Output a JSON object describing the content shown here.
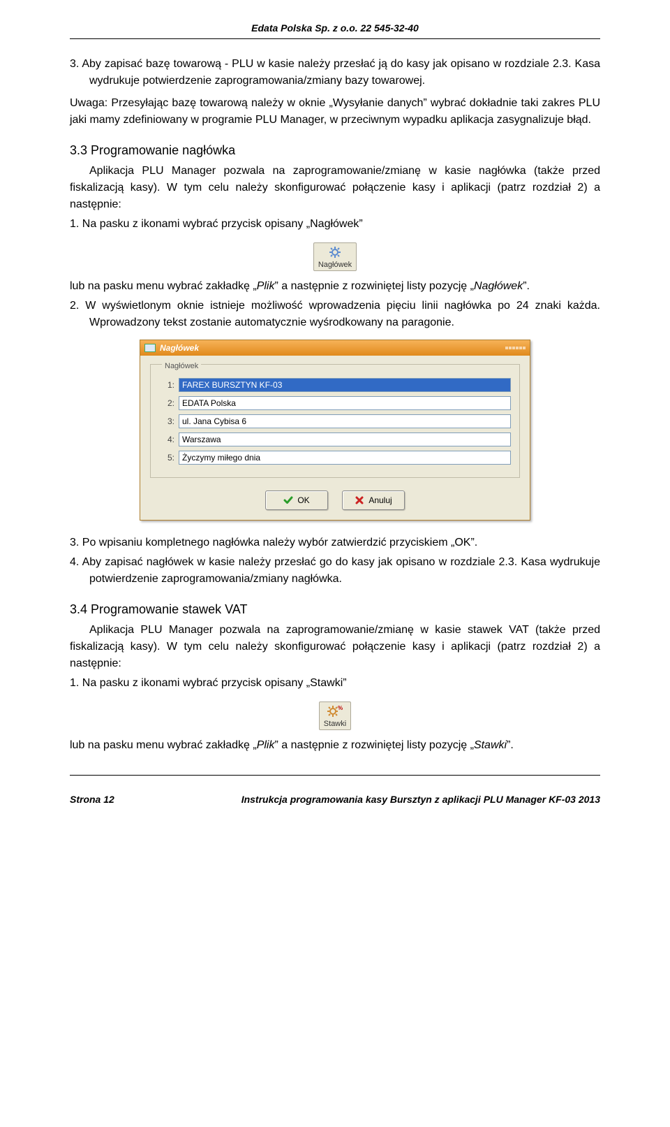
{
  "header": {
    "company": "Edata Polska Sp. z o.o. 22 545-32-40"
  },
  "p1_item3": "3.  Aby zapisać bazę towarową - PLU w kasie należy przesłać ją do kasy jak opisano w rozdziale 2.3. Kasa wydrukuje potwierdzenie zaprogramowania/zmiany bazy towarowej.",
  "p1_uwaga": "Uwaga: Przesyłając bazę towarową należy w oknie „Wysyłanie danych” wybrać dokładnie taki zakres PLU jaki mamy zdefiniowany w programie PLU Manager, w przeciwnym wypadku aplikacja zasygnalizuje błąd.",
  "sec33_title": "3.3 Programowanie nagłówka",
  "sec33_p1": "Aplikacja PLU Manager pozwala na zaprogramowanie/zmianę w kasie nagłówka (także przed fiskalizacją kasy). W tym celu należy skonfigurować połączenie kasy i aplikacji (patrz rozdział 2) a następnie:",
  "sec33_li1": "1.  Na pasku z ikonami wybrać przycisk opisany „Nagłówek”",
  "btn_naglowek_label": "Nagłówek",
  "sec33_p2_a": "lub na pasku menu wybrać zakładkę „",
  "sec33_p2_i": "Plik",
  "sec33_p2_b": "” a następnie z rozwiniętej listy pozycję „",
  "sec33_p2_i2": "Nagłówek",
  "sec33_p2_c": "”.",
  "sec33_li2": "2.  W wyświetlonym oknie istnieje możliwość wprowadzenia pięciu linii nagłówka po 24 znaki każda. Wprowadzony tekst zostanie automatycznie wyśrodkowany na paragonie.",
  "dialog": {
    "title": "Nagłówek",
    "legend": "Nagłówek",
    "rows": [
      {
        "num": "1:",
        "value": "FAREX BURSZTYN KF-03",
        "selected": true
      },
      {
        "num": "2:",
        "value": "EDATA Polska",
        "selected": false
      },
      {
        "num": "3:",
        "value": "ul. Jana Cybisa 6",
        "selected": false
      },
      {
        "num": "4:",
        "value": "Warszawa",
        "selected": false
      },
      {
        "num": "5:",
        "value": "Życzymy miłego dnia",
        "selected": false
      }
    ],
    "ok": "OK",
    "cancel": "Anuluj"
  },
  "sec33_li3": "3.  Po wpisaniu kompletnego nagłówka należy wybór zatwierdzić przyciskiem „OK”.",
  "sec33_li4": "4.  Aby zapisać nagłówek w kasie należy przesłać go do kasy jak opisano w rozdziale 2.3. Kasa wydrukuje potwierdzenie zaprogramowania/zmiany nagłówka.",
  "sec34_title": "3.4 Programowanie stawek VAT",
  "sec34_p1": "Aplikacja PLU Manager pozwala na zaprogramowanie/zmianę w kasie stawek VAT (także przed fiskalizacją kasy). W tym celu należy skonfigurować połączenie kasy i aplikacji (patrz rozdział 2) a następnie:",
  "sec34_li1": "1.  Na pasku z ikonami wybrać przycisk opisany „Stawki”",
  "btn_stawki_label": "Stawki",
  "sec34_p2_a": "lub na pasku menu wybrać zakładkę „",
  "sec34_p2_i": "Plik",
  "sec34_p2_b": "” a następnie z rozwiniętej listy pozycję „",
  "sec34_p2_i2": "Stawki",
  "sec34_p2_c": "”.",
  "footer": {
    "page": "Strona 12",
    "doc": "Instrukcja programowania kasy Bursztyn z aplikacji PLU Manager KF-03 2013"
  }
}
